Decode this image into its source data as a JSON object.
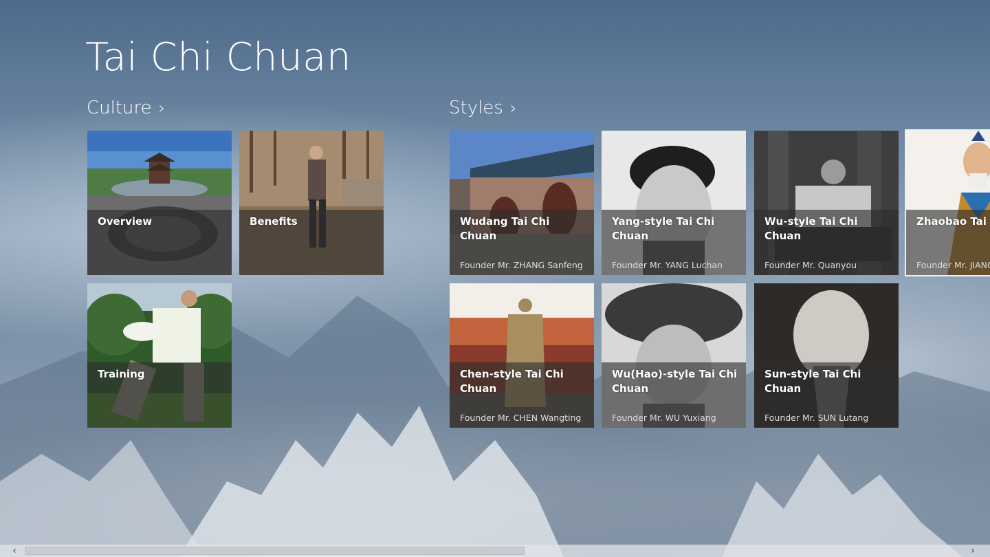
{
  "app": {
    "title": "Tai Chi Chuan"
  },
  "groups": {
    "culture": {
      "label": "Culture",
      "chevron": "›",
      "tiles": [
        {
          "title": "Overview",
          "subtitle": "",
          "icon": "pagoda-image"
        },
        {
          "title": "Benefits",
          "subtitle": "",
          "icon": "practitioner-image"
        },
        {
          "title": "Training",
          "subtitle": "",
          "icon": "training-image"
        }
      ]
    },
    "styles": {
      "label": "Styles",
      "chevron": "›",
      "tiles": [
        {
          "title": "Wudang Tai Chi Chuan",
          "subtitle": "Founder Mr. ZHANG Sanfeng",
          "icon": "temple-image"
        },
        {
          "title": "Yang-style Tai Chi Chuan",
          "subtitle": "Founder Mr. YANG Luchan",
          "icon": "portrait-image"
        },
        {
          "title": "Wu-style Tai Chi Chuan",
          "subtitle": "Founder Mr. Quanyou",
          "icon": "portrait-image"
        },
        {
          "title": "Zhaobao Tai Chi Chuan",
          "subtitle": "Founder Mr. JIANG",
          "icon": "portrait-image"
        },
        {
          "title": "Chen-style Tai Chi Chuan",
          "subtitle": "Founder Mr. CHEN Wangting",
          "icon": "statue-image"
        },
        {
          "title": "Wu(Hao)-style Tai Chi Chuan",
          "subtitle": "Founder Mr. WU Yuxiang",
          "icon": "portrait-image"
        },
        {
          "title": "Sun-style Tai Chi Chuan",
          "subtitle": "Founder Mr. SUN Lutang",
          "icon": "portrait-image"
        }
      ]
    }
  },
  "scrollbar": {
    "left_arrow": "‹",
    "right_arrow": "›",
    "scroll_fraction": 0.52
  },
  "colors": {
    "tile_overlay": "#2d2d2d",
    "text": "#ffffff",
    "sky": "#4d6a8a"
  }
}
